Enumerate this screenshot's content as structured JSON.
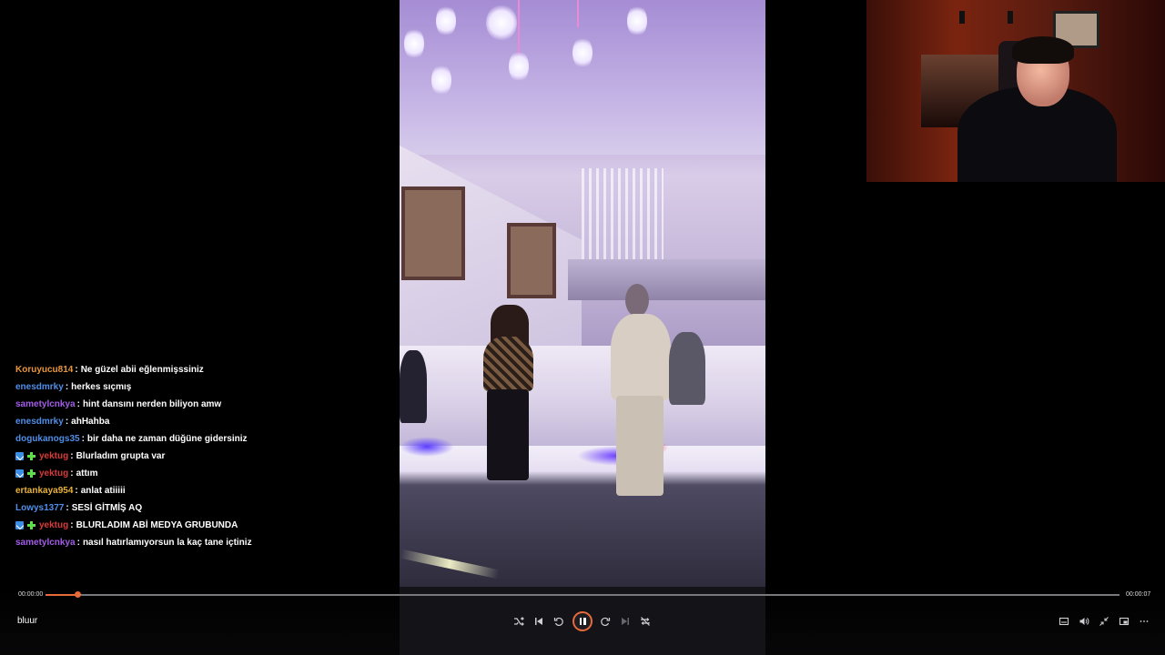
{
  "player": {
    "title": "bluur",
    "current_time": "00:00:00",
    "duration": "00:00:07",
    "progress": 0.03,
    "accent_color": "#e76a3a"
  },
  "controls": {
    "left": [
      "shuffle-icon",
      "skip-previous-icon",
      "rewind-icon",
      "pause-icon",
      "forward-icon",
      "skip-next-icon",
      "loop-off-icon"
    ],
    "right": [
      "subtitles-icon",
      "volume-icon",
      "collapse-icon",
      "picture-in-picture-icon",
      "more-icon"
    ]
  },
  "chat": [
    {
      "user": "Koruyucu814",
      "color": "#e9963a",
      "badges": [],
      "message": "Ne güzel abii eğlenmişssiniz"
    },
    {
      "user": "enesdmrky",
      "color": "#4f8fe8",
      "badges": [],
      "message": "herkes sıçmış"
    },
    {
      "user": "sametylcnkya",
      "color": "#a25ee6",
      "badges": [],
      "message": "hint dansını nerden biliyon amw"
    },
    {
      "user": "enesdmrky",
      "color": "#4f8fe8",
      "badges": [],
      "message": "ahHahba"
    },
    {
      "user": "dogukanogs35",
      "color": "#4f8fe8",
      "badges": [],
      "message": "bir daha ne zaman düğüne gidersiniz"
    },
    {
      "user": "yektug",
      "color": "#d83a3a",
      "badges": [
        "verified",
        "plus"
      ],
      "message": "Blurladım grupta var"
    },
    {
      "user": "yektug",
      "color": "#d83a3a",
      "badges": [
        "verified",
        "plus"
      ],
      "message": "attım"
    },
    {
      "user": "ertankaya954",
      "color": "#e9b23a",
      "badges": [],
      "message": "anlat atiiiii"
    },
    {
      "user": "Lowys1377",
      "color": "#4f8fe8",
      "badges": [],
      "message": "SESİ GİTMİŞ AQ"
    },
    {
      "user": "yektug",
      "color": "#d83a3a",
      "badges": [
        "verified",
        "plus"
      ],
      "message": "BLURLADIM ABİ MEDYA GRUBUNDA"
    },
    {
      "user": "sametylcnkya",
      "color": "#a25ee6",
      "badges": [],
      "message": "nasıl hatırlamıyorsun la kaç tane içtiniz"
    }
  ]
}
